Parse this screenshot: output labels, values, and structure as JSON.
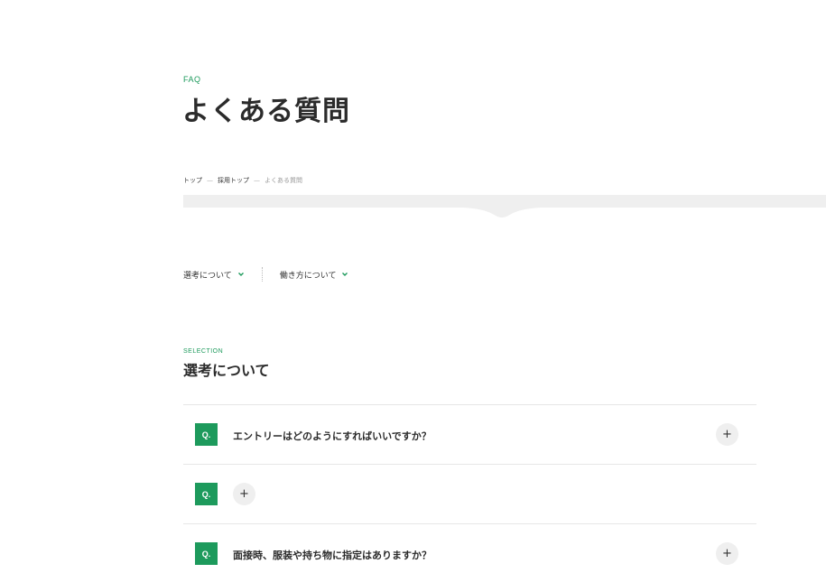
{
  "header": {
    "eyebrow": "FAQ",
    "title": "よくある質問"
  },
  "breadcrumb": {
    "items": [
      "トップ",
      "採用トップ",
      "よくある質問"
    ],
    "separator": "—"
  },
  "anchor_nav": {
    "items": [
      "選考について",
      "働き方について"
    ]
  },
  "section": {
    "eyebrow": "SELECTION",
    "title": "選考について"
  },
  "faq": {
    "badge": "Q.",
    "toggle": "+",
    "items": [
      {
        "question": "エントリーはどのようにすればいいですか？"
      },
      {
        "question": ""
      },
      {
        "question": "面接時、服装や持ち物に指定はありますか？"
      }
    ]
  },
  "colors": {
    "accent": "#1d9a5c",
    "text": "#2b2b2b",
    "band": "#efefef"
  },
  "icons": {
    "chevron": "chevron-down-icon",
    "toggle": "plus-icon"
  }
}
